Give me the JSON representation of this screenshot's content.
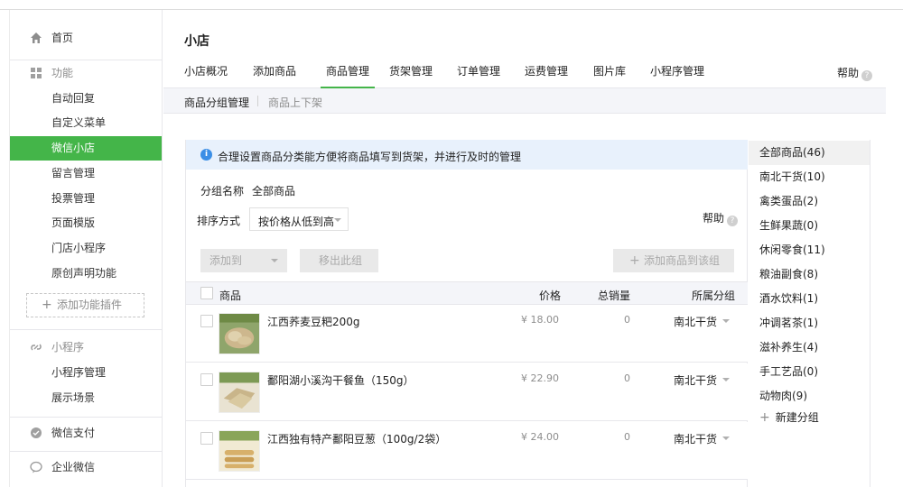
{
  "sidebar": {
    "home": "首页",
    "function_group": "功能",
    "function_items": [
      "自动回复",
      "自定义菜单",
      "微信小店",
      "留言管理",
      "投票管理",
      "页面模版",
      "门店小程序",
      "原创声明功能"
    ],
    "active_index": 2,
    "add_plugin": "添加功能插件",
    "miniprogram_group": "小程序",
    "miniprogram_items": [
      "小程序管理",
      "展示场景"
    ],
    "wechat_pay": "微信支付",
    "enterprise_wechat": "企业微信"
  },
  "header": {
    "title": "小店",
    "tabs": [
      "小店概况",
      "添加商品",
      "商品管理",
      "货架管理",
      "订单管理",
      "运费管理",
      "图片库",
      "小程序管理"
    ],
    "active_tab": 2,
    "help": "帮助"
  },
  "subtabs": [
    "商品分组管理",
    "商品上下架"
  ],
  "notice": "合理设置商品分类能方便将商品填写到货架，并进行及时的管理",
  "filters": {
    "group_name_label": "分组名称",
    "group_name_value": "全部商品",
    "sort_label": "排序方式",
    "sort_value": "按价格从低到高",
    "help": "帮助"
  },
  "toolbar": {
    "add_to": "添加到",
    "remove": "移出此组",
    "add_goods": "添加商品到该组"
  },
  "table": {
    "columns": [
      "商品",
      "价格",
      "总销量",
      "所属分组"
    ],
    "rows": [
      {
        "name": "江西荞麦豆粑200g",
        "price": "¥ 18.00",
        "sales": "0",
        "group": "南北干货"
      },
      {
        "name": "鄱阳湖小溪沟干餐鱼（150g）",
        "price": "¥ 22.90",
        "sales": "0",
        "group": "南北干货"
      },
      {
        "name": "江西独有特产鄱阳豆葱（100g/2袋）",
        "price": "¥ 24.00",
        "sales": "0",
        "group": "南北干货"
      }
    ]
  },
  "groups": {
    "items": [
      "全部商品(46)",
      "南北干货(10)",
      "禽类蛋品(2)",
      "生鲜果蔬(0)",
      "休闲零食(11)",
      "粮油副食(8)",
      "酒水饮料(1)",
      "冲调茗茶(1)",
      "滋补养生(4)",
      "手工艺品(0)",
      "动物肉(9)"
    ],
    "active_index": 0,
    "new_group": "新建分组"
  },
  "colors": {
    "accent": "#44b549",
    "notice_bg": "#e8f1fc",
    "info": "#3a8ee6"
  }
}
